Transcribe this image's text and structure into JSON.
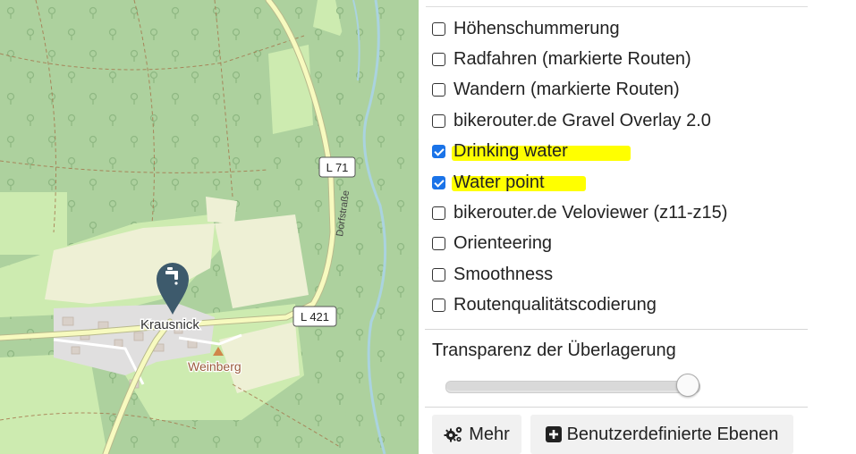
{
  "map": {
    "place_labels": [
      "Krausnick",
      "Weinberg"
    ],
    "road_labels": [
      "L 71",
      "L 421"
    ],
    "street_label": "Dorfstraße",
    "marker_icon": "water-tap-icon",
    "colors": {
      "forest": "#add19e",
      "meadow": "#cdebb0",
      "farmland": "#eef0d5",
      "water": "#aad3df",
      "major_road": "#f7fabf",
      "marker": "#3d5a6c"
    }
  },
  "layers": {
    "items": [
      {
        "label": "Höhenschummerung",
        "checked": false,
        "highlighted": false
      },
      {
        "label": "Radfahren (markierte Routen)",
        "checked": false,
        "highlighted": false
      },
      {
        "label": "Wandern (markierte Routen)",
        "checked": false,
        "highlighted": false
      },
      {
        "label": "bikerouter.de Gravel Overlay 2.0",
        "checked": false,
        "highlighted": false
      },
      {
        "label": "Drinking water",
        "checked": true,
        "highlighted": true
      },
      {
        "label": "Water point",
        "checked": true,
        "highlighted": true
      },
      {
        "label": "bikerouter.de Veloviewer (z11-z15)",
        "checked": false,
        "highlighted": false
      },
      {
        "label": "Orienteering",
        "checked": false,
        "highlighted": false
      },
      {
        "label": "Smoothness",
        "checked": false,
        "highlighted": false
      },
      {
        "label": "Routenqualitätscodierung",
        "checked": false,
        "highlighted": false
      }
    ],
    "highlight_color": "#ffff00"
  },
  "opacity": {
    "label": "Transparenz der Überlagerung",
    "value": 0.95
  },
  "buttons": {
    "more_label": "Mehr",
    "more_icon": "gears-icon",
    "custom_layers_label": "Benutzerdefinierte Ebenen",
    "custom_layers_icon": "plus-square-icon"
  }
}
